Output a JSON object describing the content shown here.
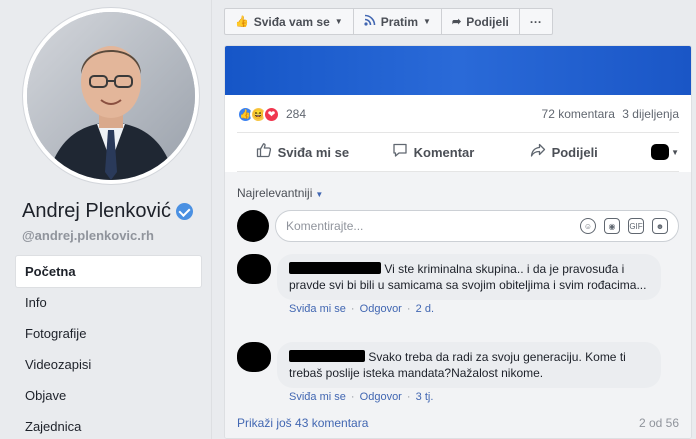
{
  "profile": {
    "name": "Andrej Plenković",
    "handle": "@andrej.plenkovic.rh"
  },
  "nav": [
    {
      "label": "Početna",
      "active": true
    },
    {
      "label": "Info"
    },
    {
      "label": "Fotografije"
    },
    {
      "label": "Videozapisi"
    },
    {
      "label": "Objave"
    },
    {
      "label": "Zajednica"
    }
  ],
  "page_actions": {
    "like": "Sviđa vam se",
    "follow": "Pratim",
    "share": "Podijeli",
    "more": "···"
  },
  "post": {
    "reaction_count": "284",
    "comment_count": "72 komentara",
    "share_count": "3 dijeljenja",
    "actions": {
      "like": "Sviđa mi se",
      "comment": "Komentar",
      "share": "Podijeli"
    }
  },
  "comments": {
    "sort_label": "Najrelevantniji",
    "composer_placeholder": "Komentirajte...",
    "items": [
      {
        "text": "Vi ste kriminalna skupina.. i da je pravosuđa i pravde svi bi bili u samicama sa svojim obiteljima i svim rođacima...",
        "like": "Sviđa mi se",
        "reply": "Odgovor",
        "time": "2 d."
      },
      {
        "text": "Svako treba da radi za svoju generaciju. Kome ti trebaš poslije isteka mandata?Nažalost nikome.",
        "like": "Sviđa mi se",
        "reply": "Odgovor",
        "time": "3 tj."
      }
    ],
    "more_link": "Prikaži još 43 komentara",
    "pagination": "2 od 56"
  },
  "colors": {
    "link": "#4267b2",
    "banner": "#1656c7",
    "verified": "#4a90e2"
  }
}
